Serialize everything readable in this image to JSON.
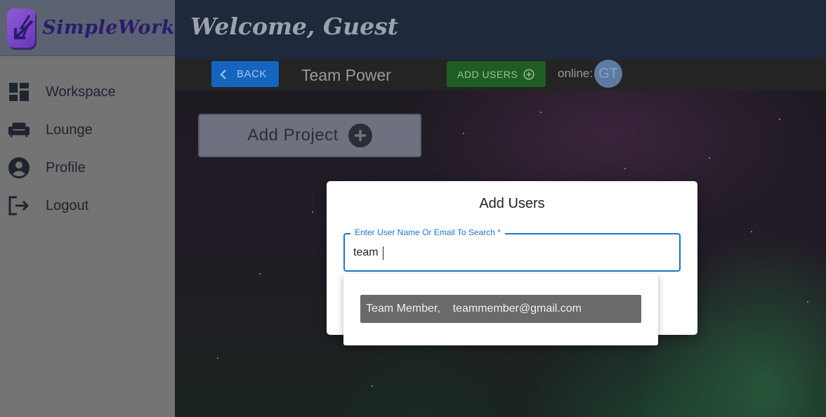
{
  "app": {
    "brand_name": "SimpleWork",
    "welcome": "Welcome, Guest"
  },
  "sidebar": {
    "items": [
      {
        "label": "Workspace",
        "icon": "dashboard-icon"
      },
      {
        "label": "Lounge",
        "icon": "couch-icon"
      },
      {
        "label": "Profile",
        "icon": "account-circle-icon"
      },
      {
        "label": "Logout",
        "icon": "logout-icon"
      }
    ]
  },
  "toolbar": {
    "back_label": "BACK",
    "team_name": "Team Power",
    "add_users_label": "ADD USERS",
    "online_label": "online:",
    "avatar_initials": "GT"
  },
  "main": {
    "add_project_label": "Add Project"
  },
  "modal": {
    "title": "Add Users",
    "search_label": "Enter User Name Or Email To Search *",
    "search_value": "team",
    "options": [
      {
        "label": "Team Member,    teammember@gmail.com"
      }
    ]
  },
  "colors": {
    "sidebar_bg": "#747474",
    "header_bg": "#1e293b",
    "back_button": "#1565c0",
    "add_users_button": "#1f5e23",
    "focus_blue": "#1976d2"
  }
}
